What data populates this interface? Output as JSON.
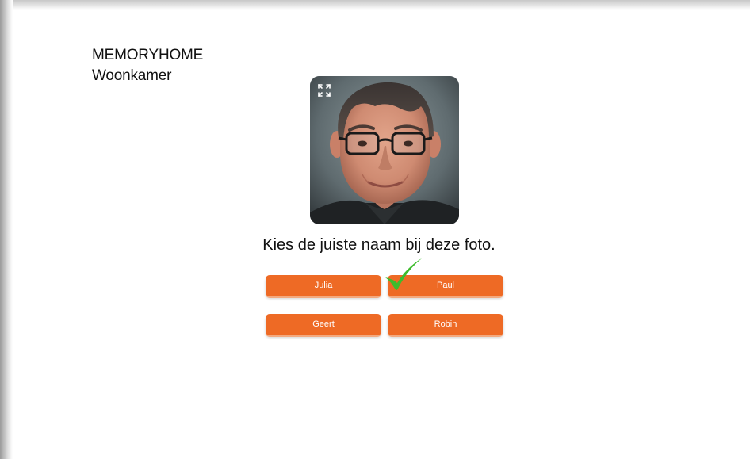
{
  "app": {
    "title": "MEMORYHOME",
    "room": "Woonkamer"
  },
  "photo": {
    "expand_icon": "expand-icon"
  },
  "quiz": {
    "question": "Kies de juiste naam bij deze foto.",
    "answers": [
      {
        "label": "Julia",
        "correct": false
      },
      {
        "label": "Paul",
        "correct": true
      },
      {
        "label": "Geert",
        "correct": false
      },
      {
        "label": "Robin",
        "correct": false
      }
    ],
    "feedback_icon": "checkmark-icon"
  },
  "colors": {
    "button": "#ee6a25",
    "checkmark": "#3dbb2c",
    "text": "#111111"
  }
}
